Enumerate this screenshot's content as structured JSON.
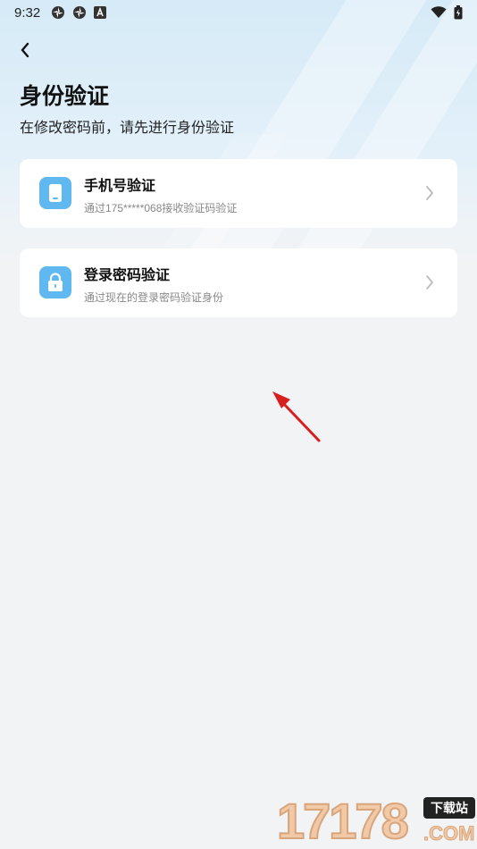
{
  "status_bar": {
    "time": "9:32",
    "left_icons": [
      "app-icon-1",
      "app-icon-2",
      "a-icon"
    ],
    "right_icons": [
      "wifi-icon",
      "battery-icon"
    ]
  },
  "header": {
    "back_icon": "chevron-left-icon",
    "title": "身份验证",
    "subtitle": "在修改密码前，请先进行身份验证"
  },
  "options": [
    {
      "icon": "phone-icon",
      "title": "手机号验证",
      "description": "通过175*****068接收验证码验证"
    },
    {
      "icon": "lock-icon",
      "title": "登录密码验证",
      "description": "通过现在的登录密码验证身份"
    }
  ],
  "watermark": {
    "number": "17178",
    "badge": "下载站",
    "domain": ".COM"
  },
  "colors": {
    "accent": "#5fb8f0",
    "background": "#f2f3f5",
    "card": "#ffffff",
    "annotation_arrow": "#d81f1f"
  }
}
